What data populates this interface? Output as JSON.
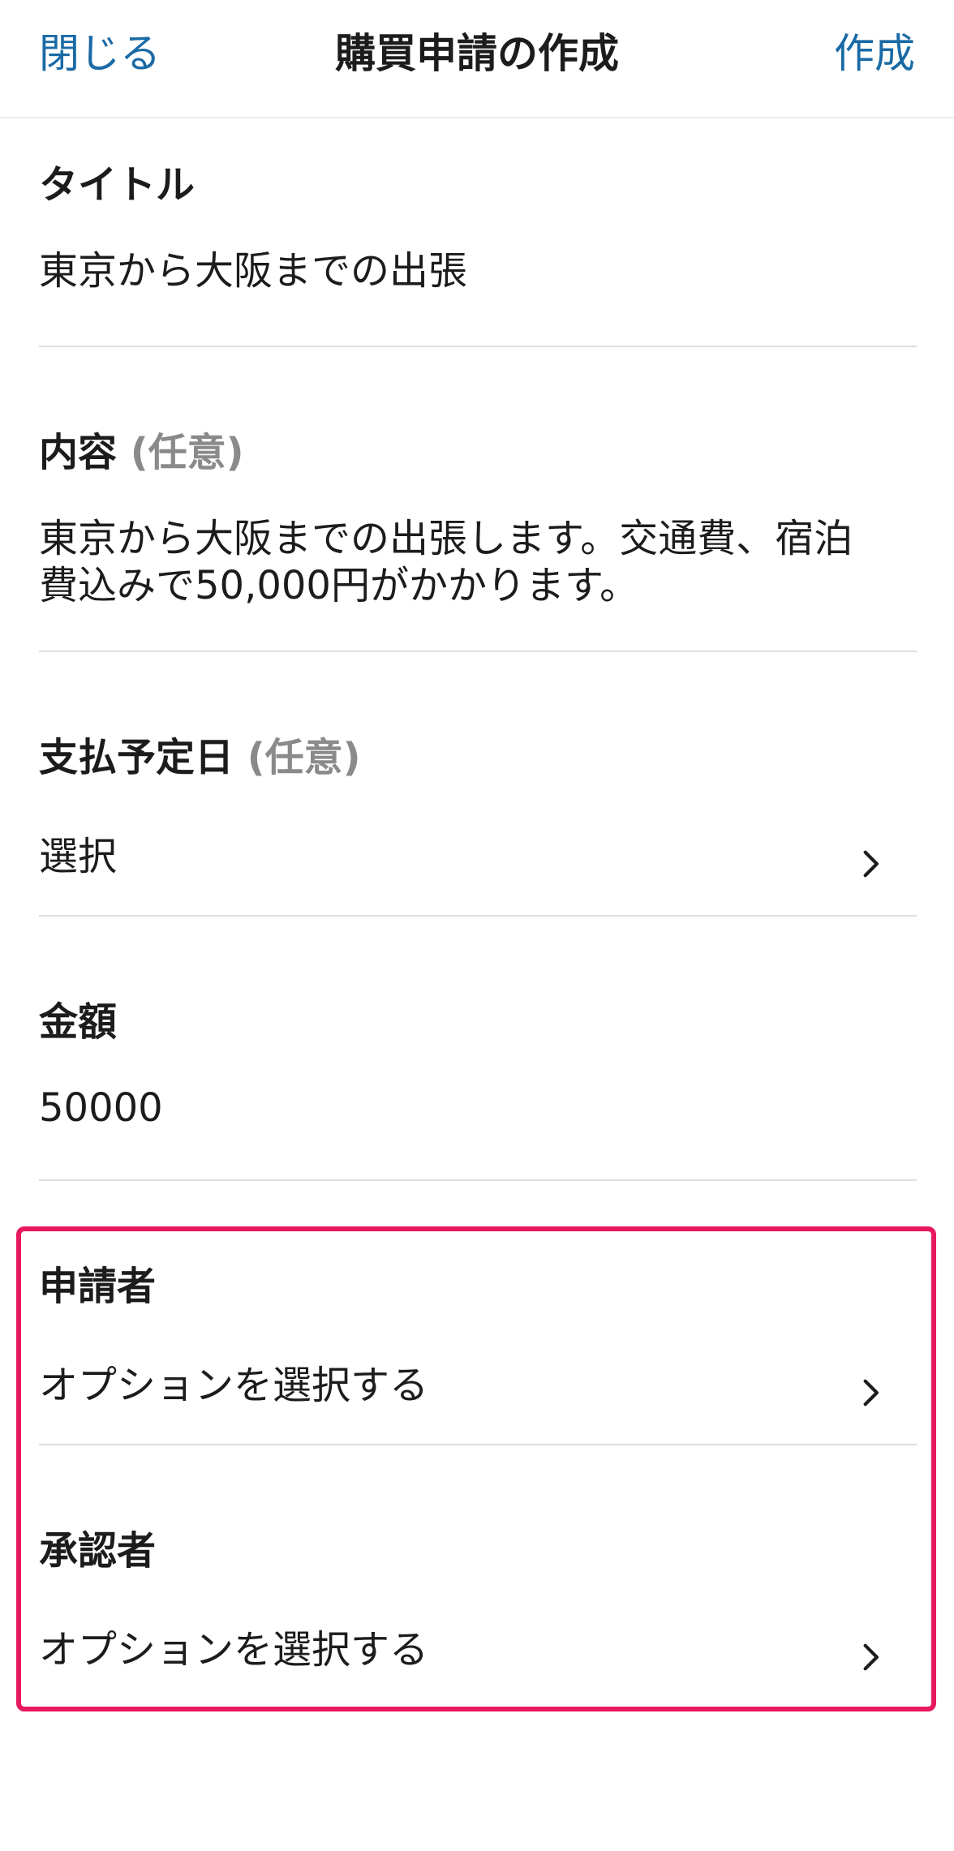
{
  "header": {
    "close_label": "閉じる",
    "title": "購買申請の作成",
    "create_label": "作成"
  },
  "form": {
    "title_field": {
      "label": "タイトル",
      "value": "東京から大阪までの出張"
    },
    "content_field": {
      "label": "内容",
      "optional": "(任意)",
      "value": "東京から大阪までの出張します。交通費、宿泊\n費込みで50,000円がかかります。"
    },
    "payment_date_field": {
      "label": "支払予定日",
      "optional": "(任意)",
      "value": "選択"
    },
    "amount_field": {
      "label": "金額",
      "value": "50000"
    },
    "applicant_field": {
      "label": "申請者",
      "value": "オプションを選択する"
    },
    "approver_field": {
      "label": "承認者",
      "value": "オプションを選択する"
    }
  },
  "colors": {
    "accent": "#1a6aa6",
    "highlight": "#e8185e",
    "optional_text": "#8a8a8a"
  },
  "icons": {
    "chevron": "chevron-right-icon"
  }
}
